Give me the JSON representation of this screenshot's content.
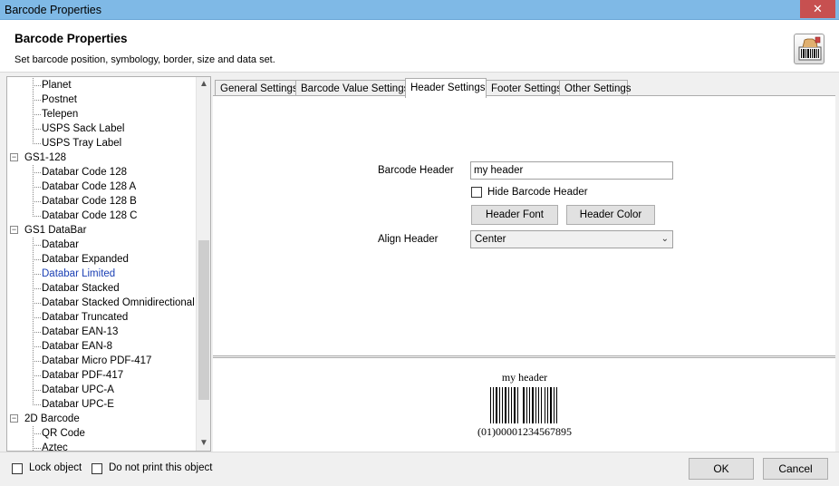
{
  "window": {
    "title": "Barcode Properties",
    "close_glyph": "✕"
  },
  "header": {
    "title": "Barcode Properties",
    "subtitle": "Set barcode position, symbology, border, size and data set.",
    "icon": "barcode-hand-icon"
  },
  "tree": {
    "items": [
      {
        "label": "Planet",
        "level": 1
      },
      {
        "label": "Postnet",
        "level": 1
      },
      {
        "label": "Telepen",
        "level": 1
      },
      {
        "label": "USPS Sack Label",
        "level": 1
      },
      {
        "label": "USPS Tray Label",
        "level": 1
      },
      {
        "label": "GS1-128",
        "level": 0
      },
      {
        "label": "Databar Code 128",
        "level": 1
      },
      {
        "label": "Databar Code 128 A",
        "level": 1
      },
      {
        "label": "Databar Code 128 B",
        "level": 1
      },
      {
        "label": "Databar Code 128 C",
        "level": 1
      },
      {
        "label": "GS1 DataBar",
        "level": 0
      },
      {
        "label": "Databar",
        "level": 1
      },
      {
        "label": "Databar Expanded",
        "level": 1
      },
      {
        "label": "Databar Limited",
        "level": 1,
        "selected": true
      },
      {
        "label": "Databar Stacked",
        "level": 1
      },
      {
        "label": "Databar Stacked Omnidirectional",
        "level": 1
      },
      {
        "label": "Databar Truncated",
        "level": 1
      },
      {
        "label": "Databar EAN-13",
        "level": 1
      },
      {
        "label": "Databar EAN-8",
        "level": 1
      },
      {
        "label": "Databar Micro PDF-417",
        "level": 1
      },
      {
        "label": "Databar PDF-417",
        "level": 1
      },
      {
        "label": "Databar UPC-A",
        "level": 1
      },
      {
        "label": "Databar UPC-E",
        "level": 1
      },
      {
        "label": "2D Barcode",
        "level": 0
      },
      {
        "label": "QR Code",
        "level": 1
      },
      {
        "label": "Aztec",
        "level": 1
      }
    ],
    "selected_color": "#1a3fb4"
  },
  "tabs": [
    {
      "label": "General Settings",
      "active": false
    },
    {
      "label": "Barcode Value Settings",
      "active": false
    },
    {
      "label": "Header Settings",
      "active": true
    },
    {
      "label": "Footer Settings",
      "active": false
    },
    {
      "label": "Other Settings",
      "active": false
    }
  ],
  "header_settings": {
    "barcode_header_label": "Barcode Header",
    "barcode_header_value": "my header",
    "hide_header_label": "Hide Barcode Header",
    "hide_header_checked": false,
    "header_font_button": "Header Font",
    "header_color_button": "Header Color",
    "align_header_label": "Align Header",
    "align_header_value": "Center"
  },
  "preview": {
    "header_text": "my header",
    "barcode_number": "(01)00001234567895"
  },
  "footer": {
    "lock_object_label": "Lock object",
    "lock_object_checked": false,
    "no_print_label": "Do not print this object",
    "no_print_checked": false,
    "ok_label": "OK",
    "cancel_label": "Cancel"
  }
}
